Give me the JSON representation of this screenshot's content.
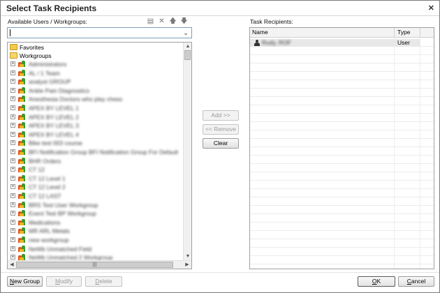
{
  "dialog": {
    "title": "Select Task Recipients",
    "close_icon": "close-icon"
  },
  "available": {
    "label": "Available Users / Workgroups:",
    "toolbar_icons": [
      "new-workgroup-icon",
      "delete-x-icon",
      "move-up-arrow-icon",
      "move-down-arrow-icon"
    ],
    "search": {
      "value": "",
      "placeholder": ""
    },
    "tree": {
      "top_items": [
        {
          "label": "Favorites",
          "icon": "folder-icon"
        },
        {
          "label": "Workgroups",
          "icon": "open-folder-icon"
        }
      ],
      "workgroups": [
        "Administrators",
        "AL / 1 Team",
        "analyst GROUP",
        "Ankle Pain Diagnostics",
        "Anesthesia Doctors who play chess",
        "APEX BY LEVEL 1",
        "APEX BY LEVEL 2",
        "APEX BY LEVEL 3",
        "APEX BY LEVEL 4",
        "Bike test 003 course",
        "BFI Notification Group BFI Notification Group For Default",
        "BHR Orders",
        "CT 12",
        "CT 12 Level 1",
        "CT 12 Level 2",
        "CT 12 LAST",
        "BRS Test User Workgroup",
        "Event Test BP Workgroup",
        "Medications",
        "MR ARL Metals",
        "new workgroup",
        "NeWb Unmatched Field",
        "NeWb Unmatched 2 Workgroup"
      ]
    }
  },
  "transfer_buttons": {
    "add": "Add >>",
    "remove": "<< Remove",
    "clear": "Clear"
  },
  "recipients": {
    "label": "Task Recipients:",
    "columns": [
      "Name",
      "Type"
    ],
    "rows": [
      {
        "name": "Rudy, ROF",
        "type": "User",
        "icon": "user-icon"
      }
    ]
  },
  "footer": {
    "new_group": "New Group",
    "modify": "Modify",
    "delete": "Delete",
    "ok": "OK",
    "cancel": "Cancel"
  }
}
